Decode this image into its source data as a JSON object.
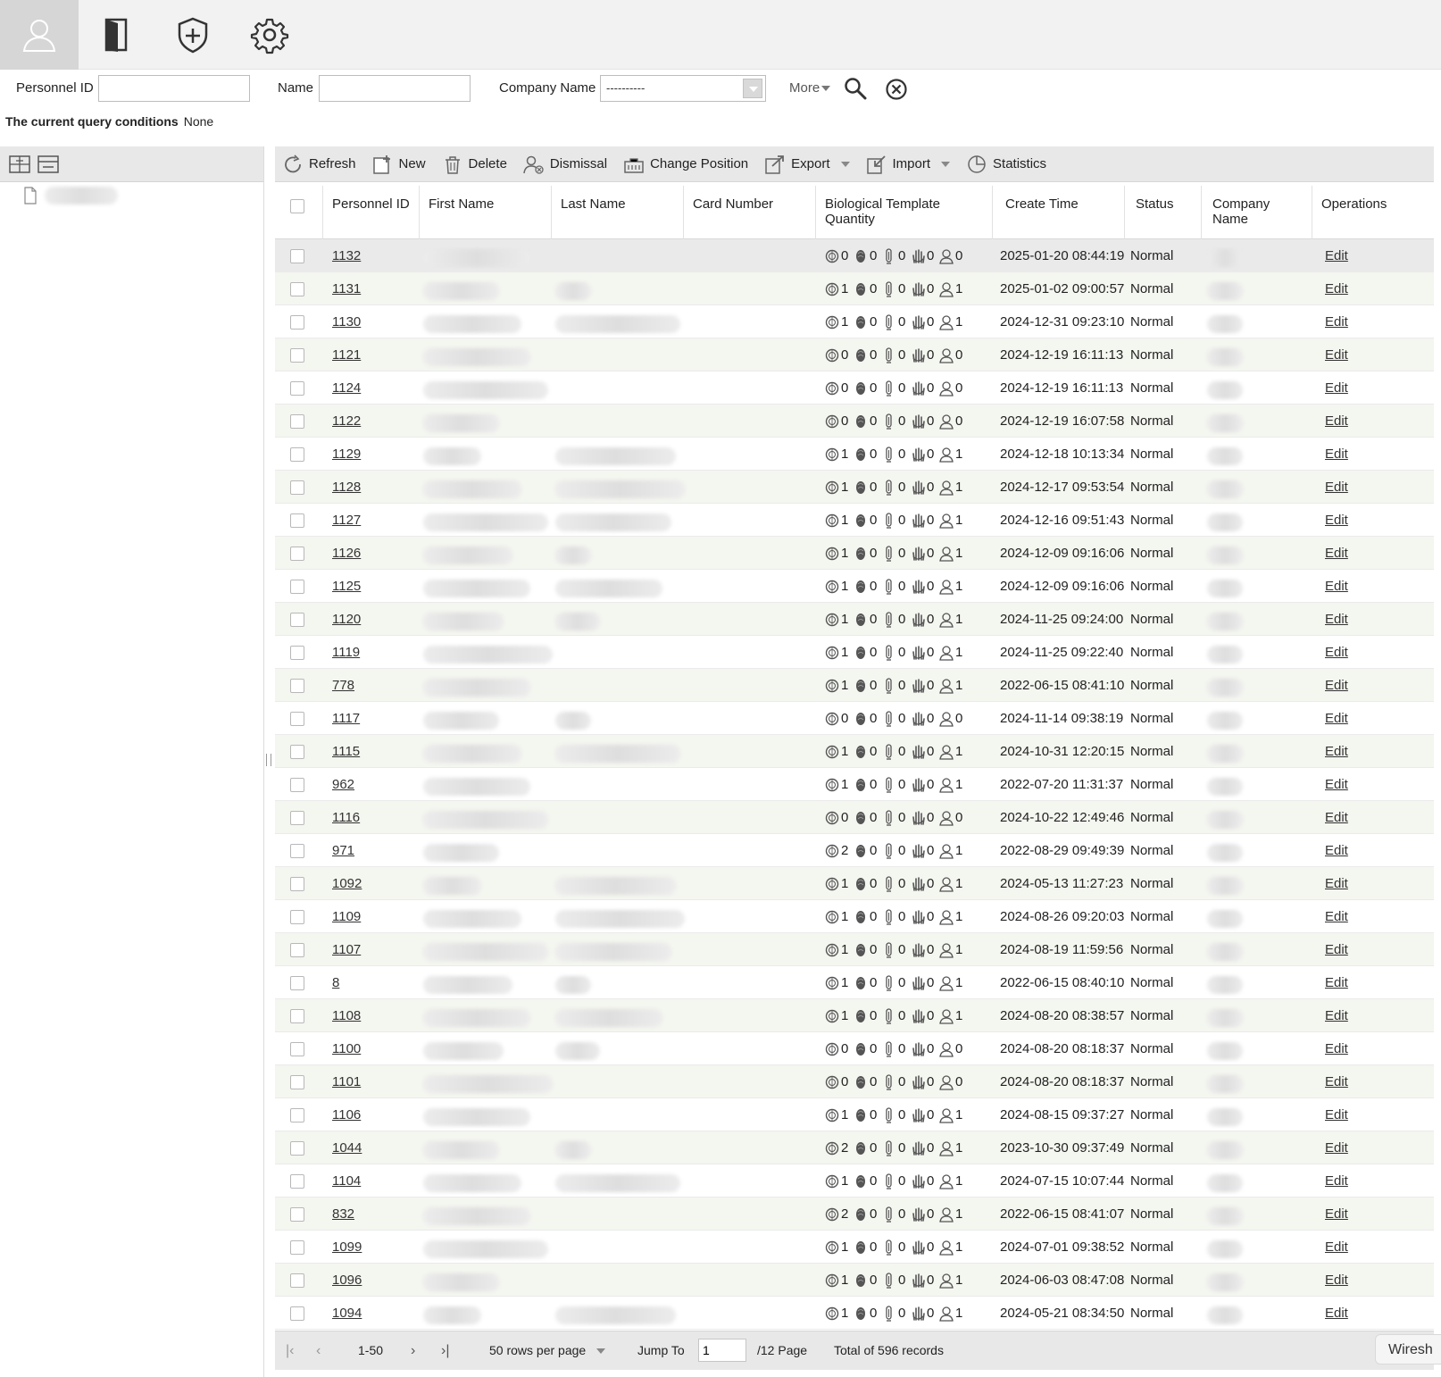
{
  "top_modules": [
    {
      "name": "personnel-module-icon",
      "active": true
    },
    {
      "name": "access-door-module-icon",
      "active": false
    },
    {
      "name": "security-module-icon",
      "active": false
    },
    {
      "name": "settings-gear-icon",
      "active": false
    }
  ],
  "search": {
    "personnel_id_label": "Personnel ID",
    "personnel_id_value": "",
    "name_label": "Name",
    "name_value": "",
    "company_label": "Company Name",
    "company_value": "----------",
    "more_label": "More"
  },
  "query": {
    "label": "The current query conditions",
    "value": "None"
  },
  "toolbar": {
    "refresh": "Refresh",
    "new": "New",
    "delete": "Delete",
    "dismissal": "Dismissal",
    "change_position": "Change Position",
    "export": "Export",
    "import": "Import",
    "statistics": "Statistics"
  },
  "columns": {
    "personnel_id": "Personnel ID",
    "first_name": "First Name",
    "last_name": "Last Name",
    "card_number": "Card Number",
    "bio": "Biological Template Quantity",
    "create_time": "Create Time",
    "status": "Status",
    "company": "Company Name",
    "operations": "Operations"
  },
  "rows": [
    {
      "id": "1132",
      "bio": [
        "0",
        "0",
        "0",
        "0",
        "0"
      ],
      "time": "2025-01-20 08:44:19",
      "status": "Normal",
      "op": "Edit"
    },
    {
      "id": "1131",
      "bio": [
        "1",
        "0",
        "0",
        "0",
        "1"
      ],
      "time": "2025-01-02 09:00:57",
      "status": "Normal",
      "op": "Edit"
    },
    {
      "id": "1130",
      "bio": [
        "1",
        "0",
        "0",
        "0",
        "1"
      ],
      "time": "2024-12-31 09:23:10",
      "status": "Normal",
      "op": "Edit"
    },
    {
      "id": "1121",
      "bio": [
        "0",
        "0",
        "0",
        "0",
        "0"
      ],
      "time": "2024-12-19 16:11:13",
      "status": "Normal",
      "op": "Edit"
    },
    {
      "id": "1124",
      "bio": [
        "0",
        "0",
        "0",
        "0",
        "0"
      ],
      "time": "2024-12-19 16:11:13",
      "status": "Normal",
      "op": "Edit"
    },
    {
      "id": "1122",
      "bio": [
        "0",
        "0",
        "0",
        "0",
        "0"
      ],
      "time": "2024-12-19 16:07:58",
      "status": "Normal",
      "op": "Edit"
    },
    {
      "id": "1129",
      "bio": [
        "1",
        "0",
        "0",
        "0",
        "1"
      ],
      "time": "2024-12-18 10:13:34",
      "status": "Normal",
      "op": "Edit"
    },
    {
      "id": "1128",
      "bio": [
        "1",
        "0",
        "0",
        "0",
        "1"
      ],
      "time": "2024-12-17 09:53:54",
      "status": "Normal",
      "op": "Edit"
    },
    {
      "id": "1127",
      "bio": [
        "1",
        "0",
        "0",
        "0",
        "1"
      ],
      "time": "2024-12-16 09:51:43",
      "status": "Normal",
      "op": "Edit"
    },
    {
      "id": "1126",
      "bio": [
        "1",
        "0",
        "0",
        "0",
        "1"
      ],
      "time": "2024-12-09 09:16:06",
      "status": "Normal",
      "op": "Edit"
    },
    {
      "id": "1125",
      "bio": [
        "1",
        "0",
        "0",
        "0",
        "1"
      ],
      "time": "2024-12-09 09:16:06",
      "status": "Normal",
      "op": "Edit"
    },
    {
      "id": "1120",
      "bio": [
        "1",
        "0",
        "0",
        "0",
        "1"
      ],
      "time": "2024-11-25 09:24:00",
      "status": "Normal",
      "op": "Edit"
    },
    {
      "id": "1119",
      "bio": [
        "1",
        "0",
        "0",
        "0",
        "1"
      ],
      "time": "2024-11-25 09:22:40",
      "status": "Normal",
      "op": "Edit"
    },
    {
      "id": "778",
      "bio": [
        "1",
        "0",
        "0",
        "0",
        "1"
      ],
      "time": "2022-06-15 08:41:10",
      "status": "Normal",
      "op": "Edit"
    },
    {
      "id": "1117",
      "bio": [
        "0",
        "0",
        "0",
        "0",
        "0"
      ],
      "time": "2024-11-14 09:38:19",
      "status": "Normal",
      "op": "Edit"
    },
    {
      "id": "1115",
      "bio": [
        "1",
        "0",
        "0",
        "0",
        "1"
      ],
      "time": "2024-10-31 12:20:15",
      "status": "Normal",
      "op": "Edit"
    },
    {
      "id": "962",
      "bio": [
        "1",
        "0",
        "0",
        "0",
        "1"
      ],
      "time": "2022-07-20 11:31:37",
      "status": "Normal",
      "op": "Edit"
    },
    {
      "id": "1116",
      "bio": [
        "0",
        "0",
        "0",
        "0",
        "0"
      ],
      "time": "2024-10-22 12:49:46",
      "status": "Normal",
      "op": "Edit"
    },
    {
      "id": "971",
      "bio": [
        "2",
        "0",
        "0",
        "0",
        "1"
      ],
      "time": "2022-08-29 09:49:39",
      "status": "Normal",
      "op": "Edit"
    },
    {
      "id": "1092",
      "bio": [
        "1",
        "0",
        "0",
        "0",
        "1"
      ],
      "time": "2024-05-13 11:27:23",
      "status": "Normal",
      "op": "Edit"
    },
    {
      "id": "1109",
      "bio": [
        "1",
        "0",
        "0",
        "0",
        "1"
      ],
      "time": "2024-08-26 09:20:03",
      "status": "Normal",
      "op": "Edit"
    },
    {
      "id": "1107",
      "bio": [
        "1",
        "0",
        "0",
        "0",
        "1"
      ],
      "time": "2024-08-19 11:59:56",
      "status": "Normal",
      "op": "Edit"
    },
    {
      "id": "8",
      "bio": [
        "1",
        "0",
        "0",
        "0",
        "1"
      ],
      "time": "2022-06-15 08:40:10",
      "status": "Normal",
      "op": "Edit"
    },
    {
      "id": "1108",
      "bio": [
        "1",
        "0",
        "0",
        "0",
        "1"
      ],
      "time": "2024-08-20 08:38:57",
      "status": "Normal",
      "op": "Edit"
    },
    {
      "id": "1100",
      "bio": [
        "0",
        "0",
        "0",
        "0",
        "0"
      ],
      "time": "2024-08-20 08:18:37",
      "status": "Normal",
      "op": "Edit"
    },
    {
      "id": "1101",
      "bio": [
        "0",
        "0",
        "0",
        "0",
        "0"
      ],
      "time": "2024-08-20 08:18:37",
      "status": "Normal",
      "op": "Edit"
    },
    {
      "id": "1106",
      "bio": [
        "1",
        "0",
        "0",
        "0",
        "1"
      ],
      "time": "2024-08-15 09:37:27",
      "status": "Normal",
      "op": "Edit"
    },
    {
      "id": "1044",
      "bio": [
        "2",
        "0",
        "0",
        "0",
        "1"
      ],
      "time": "2023-10-30 09:37:49",
      "status": "Normal",
      "op": "Edit"
    },
    {
      "id": "1104",
      "bio": [
        "1",
        "0",
        "0",
        "0",
        "1"
      ],
      "time": "2024-07-15 10:07:44",
      "status": "Normal",
      "op": "Edit"
    },
    {
      "id": "832",
      "bio": [
        "2",
        "0",
        "0",
        "0",
        "1"
      ],
      "time": "2022-06-15 08:41:07",
      "status": "Normal",
      "op": "Edit"
    },
    {
      "id": "1099",
      "bio": [
        "1",
        "0",
        "0",
        "0",
        "1"
      ],
      "time": "2024-07-01 09:38:52",
      "status": "Normal",
      "op": "Edit"
    },
    {
      "id": "1096",
      "bio": [
        "1",
        "0",
        "0",
        "0",
        "1"
      ],
      "time": "2024-06-03 08:47:08",
      "status": "Normal",
      "op": "Edit"
    },
    {
      "id": "1094",
      "bio": [
        "1",
        "0",
        "0",
        "0",
        "1"
      ],
      "time": "2024-05-21 08:34:50",
      "status": "Normal",
      "op": "Edit"
    }
  ],
  "pager": {
    "range": "1-50",
    "rows_per_page": "50 rows per page",
    "jump_label": "Jump To",
    "jump_value": "1",
    "pages": "/12 Page",
    "total": "Total of 596 records"
  },
  "overlay_label": "Wiresh"
}
